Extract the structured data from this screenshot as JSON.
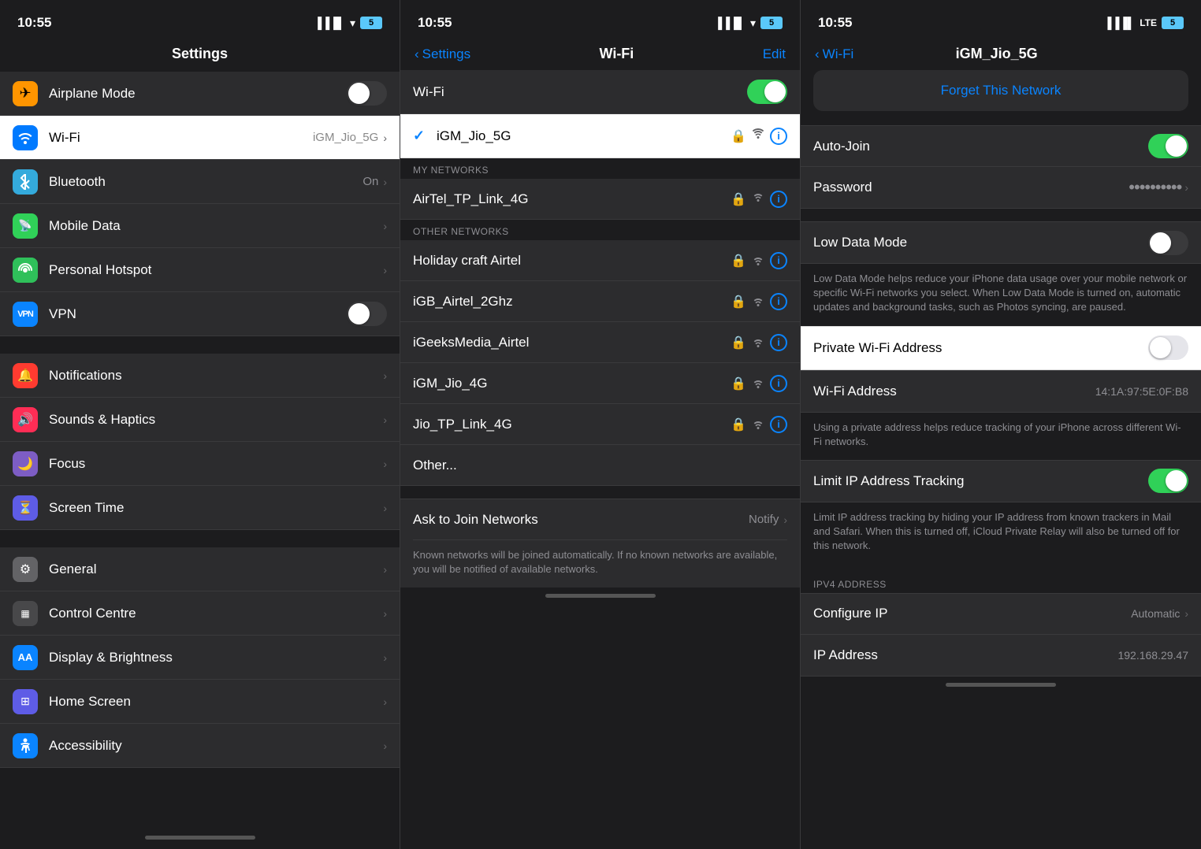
{
  "panel1": {
    "statusBar": {
      "time": "10:55",
      "battery": "5"
    },
    "title": "Settings",
    "items": [
      {
        "id": "airplane-mode",
        "label": "Airplane Mode",
        "iconColor": "icon-orange",
        "iconChar": "✈",
        "type": "toggle",
        "toggleOn": false
      },
      {
        "id": "wifi",
        "label": "Wi-Fi",
        "iconColor": "icon-blue",
        "iconChar": "📶",
        "value": "iGM_Jio_5G",
        "type": "nav",
        "highlighted": true
      },
      {
        "id": "bluetooth",
        "label": "Bluetooth",
        "iconColor": "icon-blue2",
        "iconChar": "⬡",
        "value": "On",
        "type": "nav"
      },
      {
        "id": "mobile-data",
        "label": "Mobile Data",
        "iconColor": "icon-green",
        "iconChar": "📡",
        "type": "nav"
      },
      {
        "id": "personal-hotspot",
        "label": "Personal Hotspot",
        "iconColor": "icon-green2",
        "iconChar": "🔗",
        "type": "nav"
      },
      {
        "id": "vpn",
        "label": "VPN",
        "iconColor": "icon-blue3",
        "iconChar": "VPN",
        "type": "toggle",
        "toggleOn": false
      }
    ],
    "items2": [
      {
        "id": "notifications",
        "label": "Notifications",
        "iconColor": "icon-red",
        "iconChar": "🔔",
        "type": "nav"
      },
      {
        "id": "sounds-haptics",
        "label": "Sounds & Haptics",
        "iconColor": "icon-pink",
        "iconChar": "🔊",
        "type": "nav"
      },
      {
        "id": "focus",
        "label": "Focus",
        "iconColor": "icon-purple",
        "iconChar": "🌙",
        "type": "nav"
      },
      {
        "id": "screen-time",
        "label": "Screen Time",
        "iconColor": "icon-indigo",
        "iconChar": "⏳",
        "type": "nav"
      }
    ],
    "items3": [
      {
        "id": "general",
        "label": "General",
        "iconColor": "icon-gray",
        "iconChar": "⚙",
        "type": "nav"
      },
      {
        "id": "control-centre",
        "label": "Control Centre",
        "iconColor": "icon-gray",
        "iconChar": "▦",
        "type": "nav"
      },
      {
        "id": "display-brightness",
        "label": "Display & Brightness",
        "iconColor": "icon-blue3",
        "iconChar": "AA",
        "type": "nav"
      },
      {
        "id": "home-screen",
        "label": "Home Screen",
        "iconColor": "icon-indigo",
        "iconChar": "⊞",
        "type": "nav"
      },
      {
        "id": "accessibility",
        "label": "Accessibility",
        "iconColor": "icon-blue3",
        "iconChar": "♿",
        "type": "nav"
      }
    ]
  },
  "panel2": {
    "statusBar": {
      "time": "10:55",
      "battery": "5"
    },
    "backLabel": "Settings",
    "title": "Wi-Fi",
    "editLabel": "Edit",
    "toggleLabel": "Wi-Fi",
    "toggleOn": true,
    "connectedNetwork": {
      "name": "iGM_Jio_5G",
      "locked": true
    },
    "myNetworksHeader": "MY NETWORKS",
    "myNetworks": [
      {
        "name": "AirTel_TP_Link_4G",
        "locked": true
      }
    ],
    "otherNetworksHeader": "OTHER NETWORKS",
    "otherNetworks": [
      {
        "name": "Holiday craft Airtel",
        "locked": true
      },
      {
        "name": "iGB_Airtel_2Ghz",
        "locked": true
      },
      {
        "name": "iGeeksMedia_Airtel",
        "locked": true
      },
      {
        "name": "iGM_Jio_4G",
        "locked": true
      },
      {
        "name": "Jio_TP_Link_4G",
        "locked": true
      },
      {
        "name": "Other...",
        "locked": false
      }
    ],
    "askToJoinLabel": "Ask to Join Networks",
    "askToJoinValue": "Notify",
    "askToJoinHint": "Known networks will be joined automatically. If no known networks are available, you will be notified of available networks."
  },
  "panel3": {
    "statusBar": {
      "time": "10:55",
      "battery": "LTE"
    },
    "backLabel": "Wi-Fi",
    "title": "iGM_Jio_5G",
    "forgetNetwork": "Forget This Network",
    "rows": [
      {
        "label": "Auto-Join",
        "value": "",
        "type": "toggle",
        "on": true
      },
      {
        "label": "Password",
        "value": "dots",
        "type": "dots"
      }
    ],
    "lowDataMode": {
      "label": "Low Data Mode",
      "on": false,
      "note": "Low Data Mode helps reduce your iPhone data usage over your mobile network or specific Wi-Fi networks you select. When Low Data Mode is turned on, automatic updates and background tasks, such as Photos syncing, are paused."
    },
    "privateAddress": {
      "label": "Private Wi-Fi Address",
      "on": false
    },
    "wifiAddress": {
      "label": "Wi-Fi Address",
      "value": "14:1A:97:5E:0F:B8"
    },
    "wifiAddressNote": "Using a private address helps reduce tracking of your iPhone across different Wi-Fi networks.",
    "limitIPTracking": {
      "label": "Limit IP Address Tracking",
      "on": true,
      "note": "Limit IP address tracking by hiding your IP address from known trackers in Mail and Safari. When this is turned off, iCloud Private Relay will also be turned off for this network."
    },
    "ipv4Header": "IPV4 ADDRESS",
    "configureIP": {
      "label": "Configure IP",
      "value": "Automatic"
    },
    "ipAddress": {
      "label": "IP Address",
      "value": "192.168.29.47"
    }
  }
}
